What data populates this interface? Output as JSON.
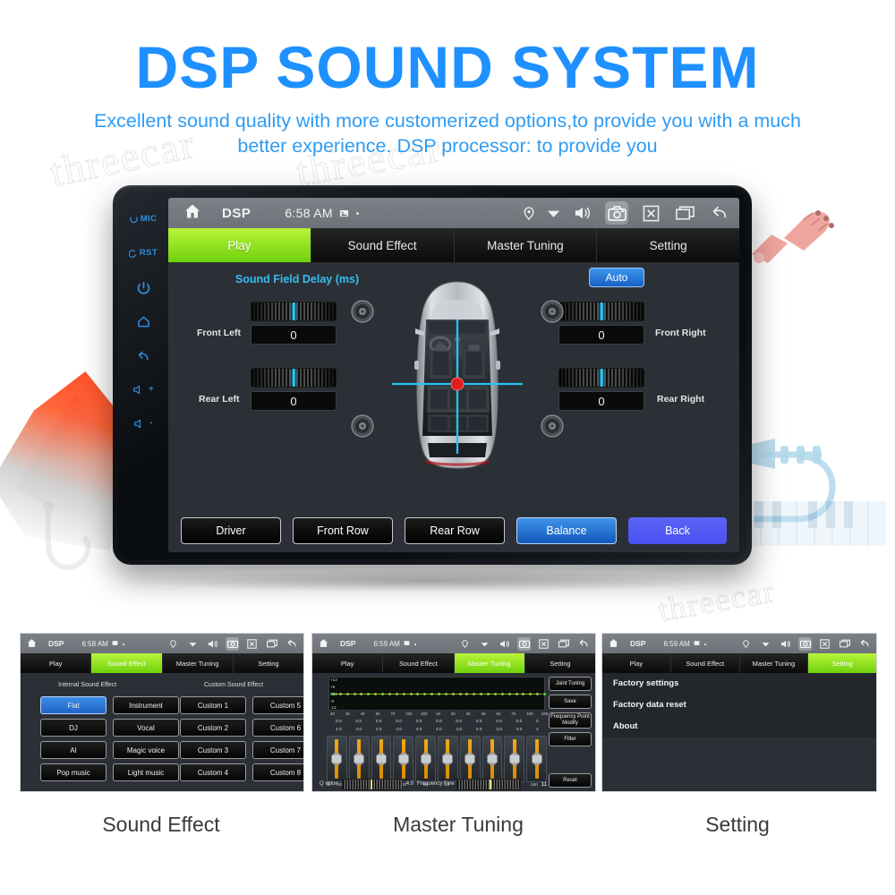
{
  "header": {
    "title": "DSP SOUND SYSTEM",
    "subtitle": "Excellent sound quality with more customerized options,to provide you with a much better experience. DSP processor: to provide you",
    "title_color": "#1e90ff",
    "subtitle_color": "#2f9cf4"
  },
  "watermark": {
    "text": "threecar"
  },
  "device": {
    "rail": [
      {
        "label": "MIC",
        "icon": "mic-icon"
      },
      {
        "label": "RST",
        "icon": "reset-icon"
      },
      {
        "label": "",
        "icon": "power-icon"
      },
      {
        "label": "",
        "icon": "home-icon"
      },
      {
        "label": "",
        "icon": "back-icon"
      },
      {
        "label": "+",
        "icon": "volume-up-icon"
      },
      {
        "label": "-",
        "icon": "volume-down-icon"
      }
    ],
    "statusbar": {
      "home_icon": "home-icon",
      "app_title": "DSP",
      "time": "6:58 AM",
      "mini_icons": [
        "sd-card-icon",
        "dot-icon"
      ],
      "right_icons": [
        "location-pin-icon",
        "wifi-icon",
        "volume-icon",
        "camera-icon",
        "close-box-icon",
        "recents-icon",
        "back-arrow-icon"
      ],
      "active_icon": "camera-icon"
    },
    "tabs": [
      {
        "label": "Play",
        "active": true
      },
      {
        "label": "Sound Effect",
        "active": false
      },
      {
        "label": "Master Tuning",
        "active": false
      },
      {
        "label": "Setting",
        "active": false
      }
    ],
    "play": {
      "section_title": "Sound Field Delay (ms)",
      "auto_label": "Auto",
      "delays": [
        {
          "label": "Front Left",
          "value": "0"
        },
        {
          "label": "Rear Left",
          "value": "0"
        },
        {
          "label": "Front Right",
          "value": "0"
        },
        {
          "label": "Rear Right",
          "value": "0"
        }
      ],
      "speakers": [
        "front-left-speaker",
        "front-right-speaker",
        "rear-left-speaker",
        "rear-right-speaker"
      ],
      "buttons": [
        {
          "label": "Driver",
          "style": "dark"
        },
        {
          "label": "Front Row",
          "style": "dark"
        },
        {
          "label": "Rear Row",
          "style": "dark"
        },
        {
          "label": "Balance",
          "style": "blue"
        },
        {
          "label": "Back",
          "style": "violet"
        }
      ]
    }
  },
  "thumbnails": [
    {
      "caption": "Sound Effect",
      "statusbar": {
        "app_title": "DSP",
        "time": "6:58 AM"
      },
      "tabs": [
        {
          "label": "Play",
          "active": false
        },
        {
          "label": "Sound Effect",
          "active": true
        },
        {
          "label": "Master Tuning",
          "active": false
        },
        {
          "label": "Setting",
          "active": false
        }
      ],
      "internal_heading": "Internal Sound Effect",
      "custom_heading": "Custom Sound Effect",
      "internal": [
        {
          "label": "Flat",
          "selected": true
        },
        {
          "label": "Instrument",
          "selected": false
        },
        {
          "label": "DJ",
          "selected": false
        },
        {
          "label": "Vocal",
          "selected": false
        },
        {
          "label": "AI",
          "selected": false
        },
        {
          "label": "Magic voice",
          "selected": false
        },
        {
          "label": "Pop music",
          "selected": false
        },
        {
          "label": "Light music",
          "selected": false
        }
      ],
      "custom": [
        {
          "label": "Custom 1"
        },
        {
          "label": "Custom 5"
        },
        {
          "label": "Custom 2"
        },
        {
          "label": "Custom 6"
        },
        {
          "label": "Custom 3"
        },
        {
          "label": "Custom 7"
        },
        {
          "label": "Custom 4"
        },
        {
          "label": "Custom 8"
        }
      ]
    },
    {
      "caption": "Master Tuning",
      "statusbar": {
        "app_title": "DSP",
        "time": "6:59 AM"
      },
      "tabs": [
        {
          "label": "Play",
          "active": false
        },
        {
          "label": "Sound Effect",
          "active": false
        },
        {
          "label": "Master Tuning",
          "active": true
        },
        {
          "label": "Setting",
          "active": false
        }
      ],
      "graph_y_labels": [
        "+12",
        "+6",
        "0dB",
        "-6",
        "-12"
      ],
      "freq_labels": [
        "20",
        "30",
        "40",
        "50",
        "70",
        "200",
        "300",
        "1K",
        "2K",
        "3K",
        "4K",
        "5K",
        "7K",
        "10K",
        "20K"
      ],
      "gain_row": [
        "0.0",
        "0.0",
        "0.0",
        "0.0",
        "0.0",
        "0.0",
        "0.0",
        "0.0",
        "0.0",
        "0.0",
        "0"
      ],
      "q_row": [
        "4.0",
        "4.0",
        "4.0",
        "4.0",
        "4.0",
        "4.0",
        "4.0",
        "4.0",
        "4.0",
        "4.0",
        "4"
      ],
      "band_freqs": [
        "20",
        "25",
        "32",
        "40",
        "50",
        "63",
        "80",
        "100",
        "125",
        "160"
      ],
      "band_start": "1",
      "band_end": "11",
      "side_buttons": [
        "Joint Tuning",
        "Save",
        "Frequency Point Modify",
        "Filter"
      ],
      "reset_label": "Reset",
      "q_value_label": "Q value",
      "q_value": "4.0",
      "fine_tune_label": "Frequency Fine Tuning"
    },
    {
      "caption": "Setting",
      "statusbar": {
        "app_title": "DSP",
        "time": "6:59 AM"
      },
      "tabs": [
        {
          "label": "Play",
          "active": false
        },
        {
          "label": "Sound Effect",
          "active": false
        },
        {
          "label": "Master Tuning",
          "active": false
        },
        {
          "label": "Setting",
          "active": true
        }
      ],
      "rows": [
        "Factory settings",
        "Factory data reset",
        "About"
      ]
    }
  ]
}
